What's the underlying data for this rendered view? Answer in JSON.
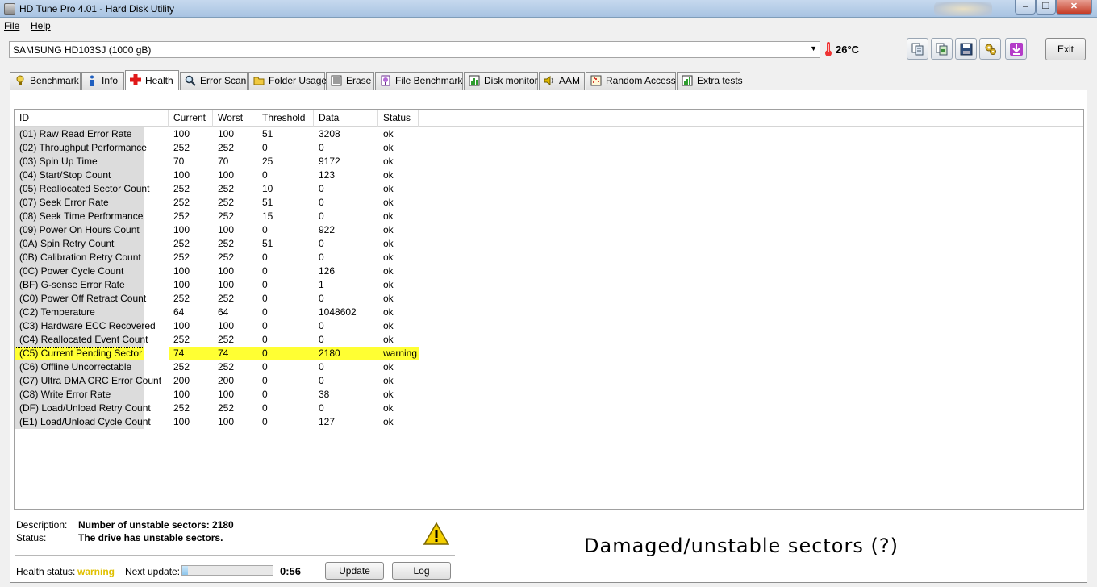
{
  "window": {
    "title": "HD Tune Pro 4.01 - Hard Disk Utility",
    "close_glyph": "✕",
    "min_glyph": "–",
    "max_glyph": "❐"
  },
  "menu": {
    "file": "File",
    "help": "Help"
  },
  "toolbar": {
    "drive": "SAMSUNG HD103SJ (1000 gB)",
    "temperature": "26°C",
    "exit_label": "Exit",
    "icons": [
      "copy-text-icon",
      "copy-screenshot-icon",
      "save-icon",
      "options-icon",
      "download-icon"
    ]
  },
  "tabs": [
    {
      "label": "Benchmark",
      "icon": "benchmark-icon"
    },
    {
      "label": "Info",
      "icon": "info-icon"
    },
    {
      "label": "Health",
      "icon": "health-icon",
      "active": true
    },
    {
      "label": "Error Scan",
      "icon": "error-scan-icon"
    },
    {
      "label": "Folder Usage",
      "icon": "folder-usage-icon"
    },
    {
      "label": "Erase",
      "icon": "erase-icon"
    },
    {
      "label": "File Benchmark",
      "icon": "file-benchmark-icon"
    },
    {
      "label": "Disk monitor",
      "icon": "disk-monitor-icon"
    },
    {
      "label": "AAM",
      "icon": "aam-icon"
    },
    {
      "label": "Random Access",
      "icon": "random-access-icon"
    },
    {
      "label": "Extra tests",
      "icon": "extra-tests-icon"
    }
  ],
  "health": {
    "columns": [
      "ID",
      "Current",
      "Worst",
      "Threshold",
      "Data",
      "Status"
    ],
    "rows": [
      [
        "(01) Raw Read Error Rate",
        "100",
        "100",
        "51",
        "3208",
        "ok"
      ],
      [
        "(02) Throughput Performance",
        "252",
        "252",
        "0",
        "0",
        "ok"
      ],
      [
        "(03) Spin Up Time",
        "70",
        "70",
        "25",
        "9172",
        "ok"
      ],
      [
        "(04) Start/Stop Count",
        "100",
        "100",
        "0",
        "123",
        "ok"
      ],
      [
        "(05) Reallocated Sector Count",
        "252",
        "252",
        "10",
        "0",
        "ok"
      ],
      [
        "(07) Seek Error Rate",
        "252",
        "252",
        "51",
        "0",
        "ok"
      ],
      [
        "(08) Seek Time Performance",
        "252",
        "252",
        "15",
        "0",
        "ok"
      ],
      [
        "(09) Power On Hours Count",
        "100",
        "100",
        "0",
        "922",
        "ok"
      ],
      [
        "(0A) Spin Retry Count",
        "252",
        "252",
        "51",
        "0",
        "ok"
      ],
      [
        "(0B) Calibration Retry Count",
        "252",
        "252",
        "0",
        "0",
        "ok"
      ],
      [
        "(0C) Power Cycle Count",
        "100",
        "100",
        "0",
        "126",
        "ok"
      ],
      [
        "(BF) G-sense Error Rate",
        "100",
        "100",
        "0",
        "1",
        "ok"
      ],
      [
        "(C0) Power Off Retract Count",
        "252",
        "252",
        "0",
        "0",
        "ok"
      ],
      [
        "(C2) Temperature",
        "64",
        "64",
        "0",
        "1048602",
        "ok"
      ],
      [
        "(C3) Hardware ECC Recovered",
        "100",
        "100",
        "0",
        "0",
        "ok"
      ],
      [
        "(C4) Reallocated Event Count",
        "252",
        "252",
        "0",
        "0",
        "ok"
      ],
      [
        "(C5) Current Pending Sector",
        "74",
        "74",
        "0",
        "2180",
        "warning"
      ],
      [
        "(C6) Offline Uncorrectable",
        "252",
        "252",
        "0",
        "0",
        "ok"
      ],
      [
        "(C7) Ultra DMA CRC Error Count",
        "200",
        "200",
        "0",
        "0",
        "ok"
      ],
      [
        "(C8) Write Error Rate",
        "100",
        "100",
        "0",
        "38",
        "ok"
      ],
      [
        "(DF) Load/Unload Retry Count",
        "252",
        "252",
        "0",
        "0",
        "ok"
      ],
      [
        "(E1) Load/Unload Cycle Count",
        "100",
        "100",
        "0",
        "127",
        "ok"
      ]
    ],
    "highlight_color": "#ffff33"
  },
  "details": {
    "description_label": "Description:",
    "description_value": "Number of unstable sectors: 2180",
    "status_label": "Status:",
    "status_value": "The drive has unstable sectors.",
    "warning_icon": "warning-icon"
  },
  "annotation": "Damaged/unstable sectors (?)",
  "statusbar": {
    "health_label": "Health status:",
    "health_value": "warning",
    "health_color": "#e0c000",
    "next_update_label": "Next update:",
    "progress": 0.06,
    "timer": "0:56",
    "update_label": "Update",
    "log_label": "Log"
  }
}
